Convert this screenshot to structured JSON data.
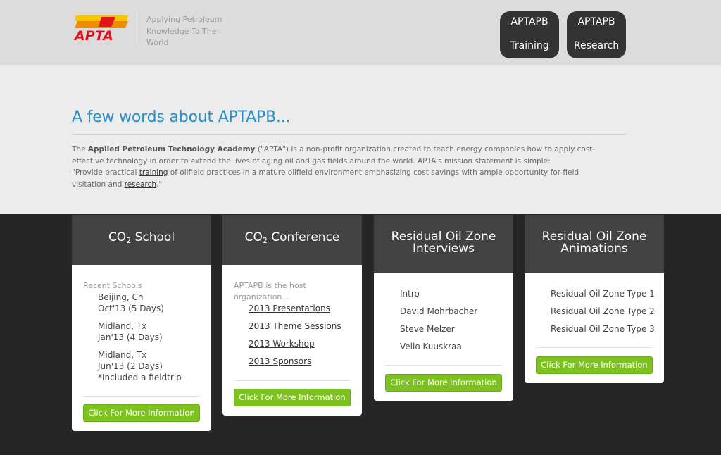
{
  "header": {
    "logo_text": "APTA",
    "tagline": "Applying Petroleum Knowledge To The World",
    "nav": [
      {
        "line1": "APTAPB",
        "line2": "Training"
      },
      {
        "line1": "APTAPB",
        "line2": "Research"
      }
    ]
  },
  "about": {
    "title": "A few words about APTAPB...",
    "p_the": "The ",
    "p_bold": "Applied Petroleum Technology Academy",
    "p_rest": " (\"APTA\") is a non-profit organization created to teach energy companies how to apply cost-effective technology in order to extend the lives of aging oil and gas fields around the world. APTA's mission statement is simple:",
    "q_start": "\"Provide practical ",
    "q_link1": "training",
    "q_mid": " of oilfield practices in a mature oilfield environment emphasizing cost savings with ample opportunity for field visitation and ",
    "q_link2": "research",
    "q_end": ".\""
  },
  "cards": [
    {
      "title_pre": "CO",
      "title_sub": "2",
      "title_post": " School",
      "intro": "Recent Schools",
      "entries": [
        {
          "l1": "Beijing, Ch",
          "l2": "Oct'13 (5 Days)"
        },
        {
          "l1": "Midland, Tx",
          "l2": "Jan'13 (4 Days)"
        },
        {
          "l1": "Midland, Tx",
          "l2": "Jun'13 (2 Days)",
          "l3": "*Included a fieldtrip"
        }
      ],
      "cta": "Click For More Information"
    },
    {
      "title_pre": "CO",
      "title_sub": "2",
      "title_post": " Conference",
      "intro": "APTAPB is the host organization...",
      "links": [
        "2013 Presentations",
        "2013 Theme Sessions",
        "2013 Workshop",
        "2013 Sponsors"
      ],
      "cta": "Click For More Information"
    },
    {
      "title_l1": "Residual Oil Zone",
      "title_l2": "Interviews",
      "items": [
        "Intro",
        "David Mohrbacher",
        "Steve Melzer",
        "Vello Kuuskraa"
      ],
      "cta": "Click For More Information"
    },
    {
      "title_l1": "Residual Oil Zone",
      "title_l2": "Animations",
      "items": [
        "Residual Oil Zone Type 1",
        "Residual Oil Zone Type 2",
        "Residual Oil Zone Type 3"
      ],
      "cta": "Click For More Information"
    }
  ],
  "colors": {
    "accent_blue": "#2b8fc7",
    "cta_green": "#7dc21e",
    "dark": "#262626",
    "logo_red": "#e1141c",
    "logo_yellow": "#f7c600"
  }
}
